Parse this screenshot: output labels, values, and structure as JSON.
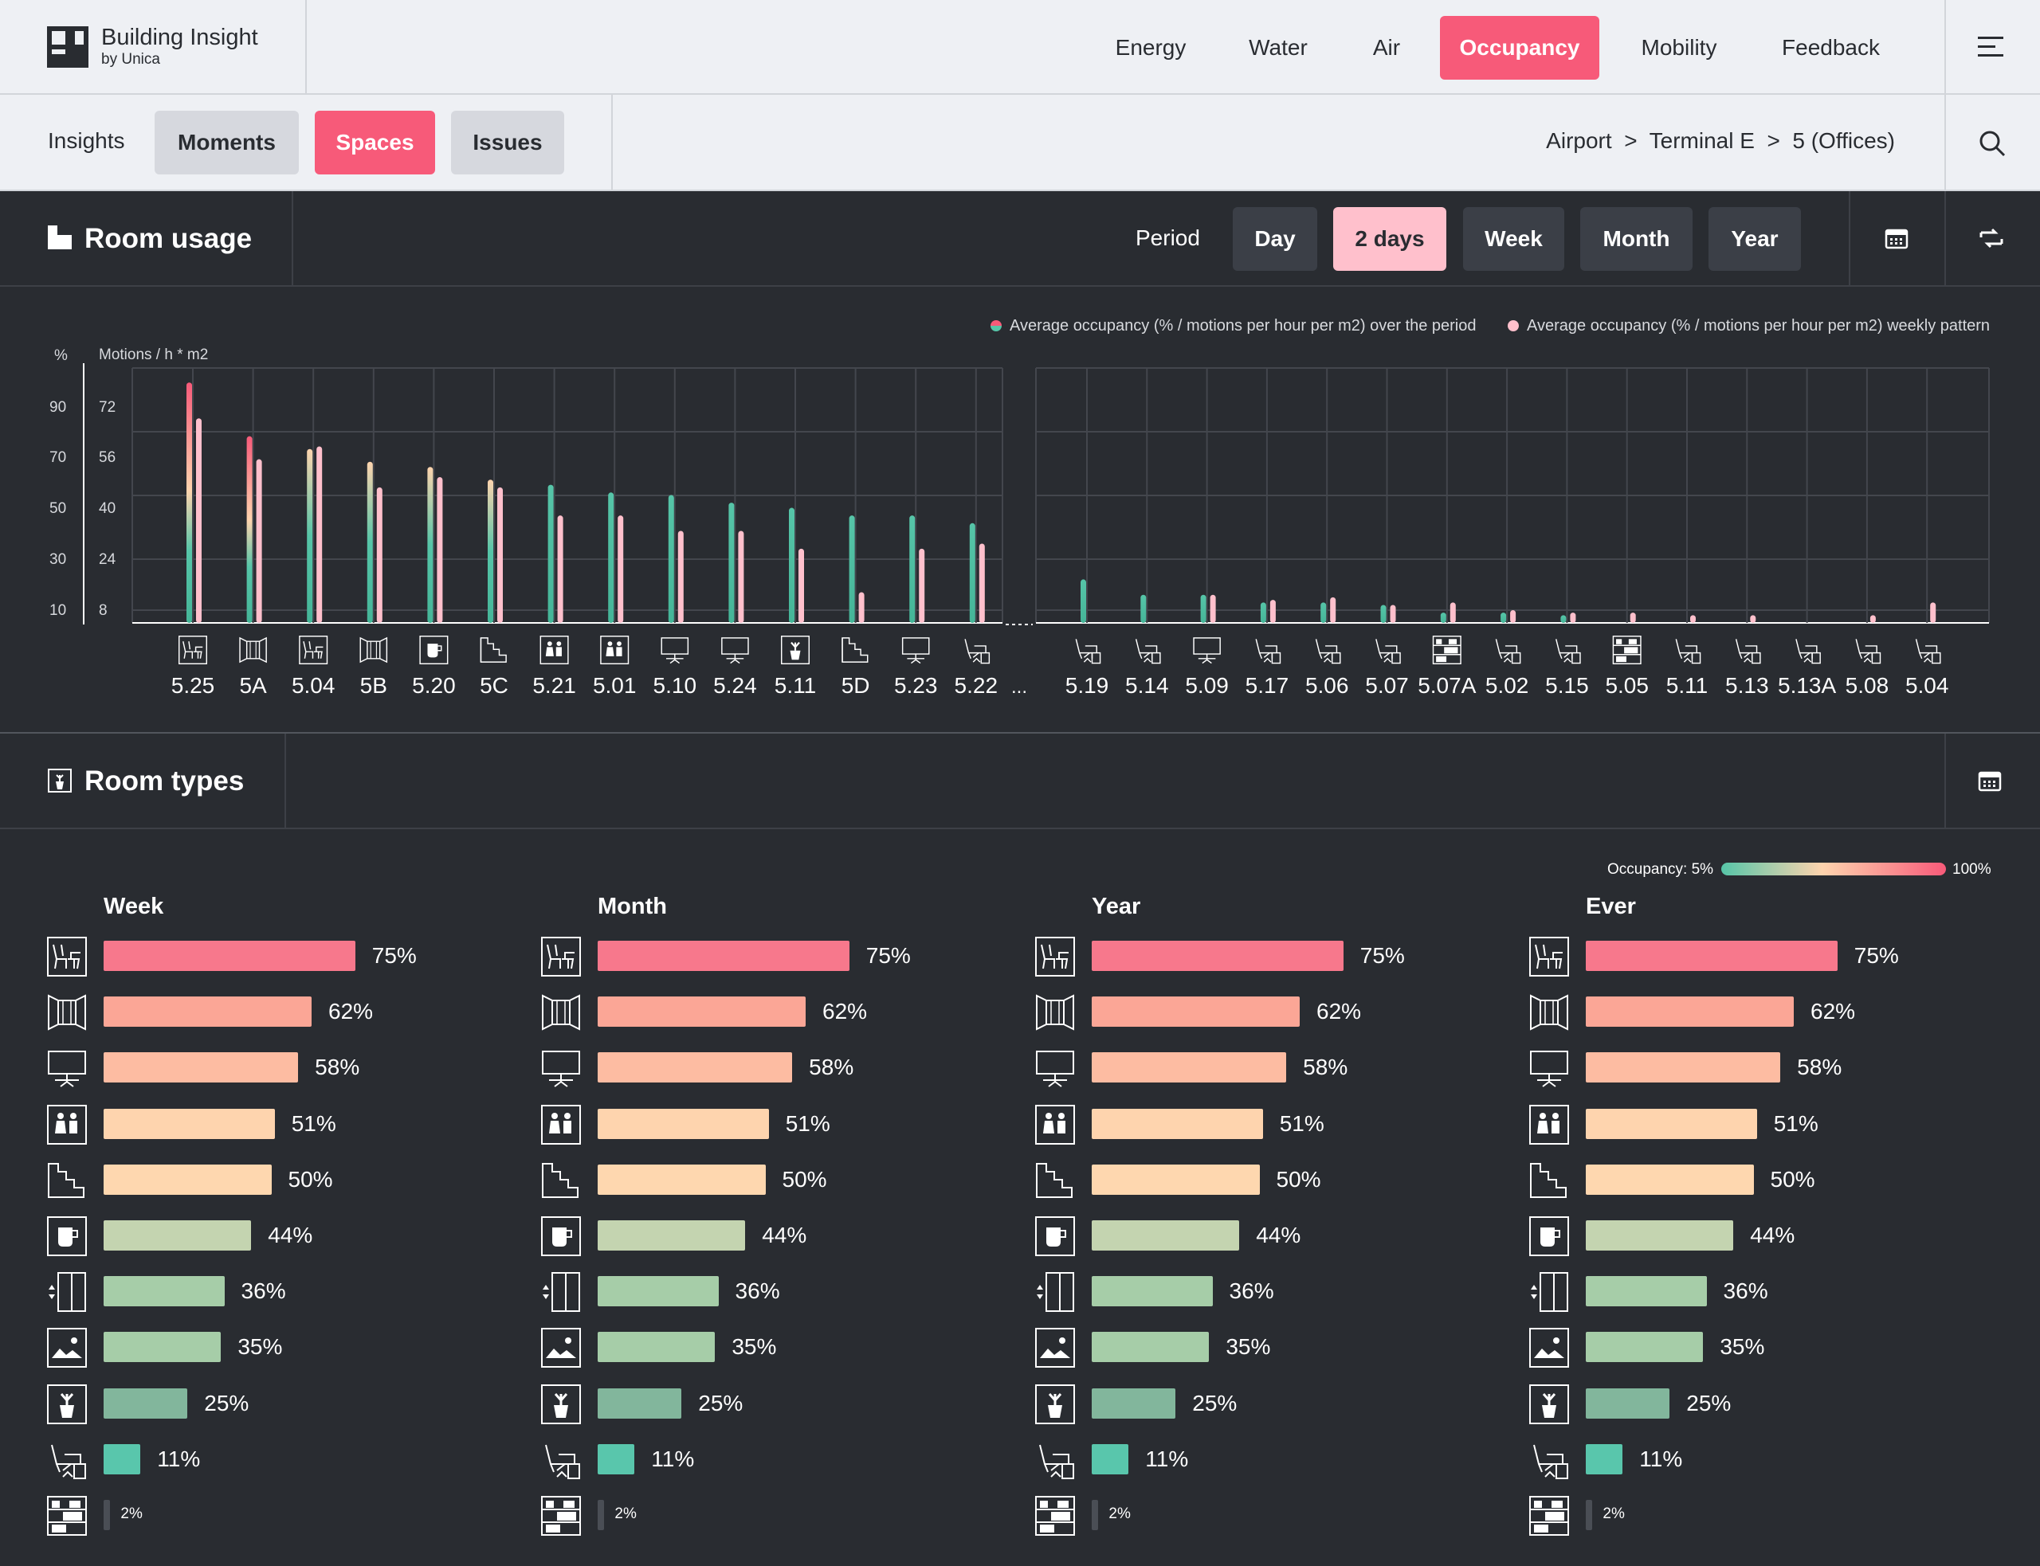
{
  "app": {
    "title": "Building Insight",
    "subtitle": "by Unica"
  },
  "nav": {
    "items": [
      "Energy",
      "Water",
      "Air",
      "Occupancy",
      "Mobility",
      "Feedback"
    ],
    "active": "Occupancy"
  },
  "subnav": {
    "insights_label": "Insights",
    "tabs": [
      "Moments",
      "Spaces",
      "Issues"
    ],
    "active": "Spaces"
  },
  "breadcrumb": {
    "items": [
      "Airport",
      "Terminal E",
      "5 (Offices)"
    ],
    "separator": ">"
  },
  "room_usage": {
    "title": "Room usage",
    "period_label": "Period",
    "periods": [
      "Day",
      "2 days",
      "Week",
      "Month",
      "Year"
    ],
    "active_period": "2 days",
    "legend": [
      "Average occupancy (% / motions per hour per m2) over the period",
      "Average occupancy (% / motions per hour per m2) weekly pattern"
    ],
    "ellipsis": "..."
  },
  "chart_data": {
    "type": "bar",
    "ylabel_left": "%",
    "ylabel_right": "Motions / h * m2",
    "yticks_pct": [
      90,
      70,
      50,
      30,
      10
    ],
    "yticks_motion": [
      72,
      56,
      40,
      24,
      8
    ],
    "ylim": [
      0,
      100
    ],
    "series": [
      {
        "name": "Average occupancy (% / motions per hour per m2) over the period",
        "values": [
          94,
          73,
          68,
          63,
          61,
          56,
          54,
          51,
          50,
          47,
          45,
          42,
          42,
          39,
          17,
          11,
          11,
          8,
          8,
          7,
          4,
          4,
          3,
          0,
          0,
          0,
          0,
          0,
          0
        ]
      },
      {
        "name": "Average occupancy (% / motions per hour per m2) weekly pattern",
        "values": [
          80,
          64,
          69,
          53,
          57,
          53,
          42,
          42,
          36,
          36,
          29,
          12,
          29,
          31,
          0,
          0,
          11,
          9,
          10,
          7,
          8,
          5,
          4,
          4,
          3,
          3,
          0,
          3,
          8
        ]
      }
    ],
    "categories": [
      "5.25",
      "5A",
      "5.04",
      "5B",
      "5.20",
      "5C",
      "5.21",
      "5.01",
      "5.10",
      "5.24",
      "5.11",
      "5D",
      "5.23",
      "5.22",
      "5.19",
      "5.14",
      "5.09",
      "5.17",
      "5.06",
      "5.07",
      "5.07A",
      "5.02",
      "5.15",
      "5.05",
      "5.11",
      "5.13",
      "5.13A",
      "5.08",
      "5.04"
    ],
    "category_icons": [
      "lounge-icon",
      "meeting-room-icon",
      "lounge-icon",
      "meeting-room-icon",
      "pantry-icon",
      "stairs-icon",
      "restroom-icon",
      "restroom-icon",
      "presentation-icon",
      "presentation-icon",
      "plant-icon",
      "stairs-icon",
      "presentation-icon",
      "office-chair-icon",
      "office-chair-icon",
      "office-chair-icon",
      "presentation-icon",
      "office-chair-icon",
      "office-chair-icon",
      "office-chair-icon",
      "storage-icon",
      "office-chair-icon",
      "office-chair-icon",
      "storage-icon",
      "office-chair-icon",
      "office-chair-icon",
      "office-chair-icon",
      "office-chair-icon",
      "office-chair-icon"
    ]
  },
  "room_types": {
    "title": "Room types",
    "occupancy_label": "Occupancy: 5%",
    "occupancy_max": "100%",
    "columns": [
      "Week",
      "Month",
      "Year",
      "Ever"
    ],
    "rows": [
      {
        "icon": "lounge-icon",
        "value": 75,
        "label": "75%",
        "color": "#f7788c"
      },
      {
        "icon": "meeting-room-icon",
        "value": 62,
        "label": "62%",
        "color": "#fba696"
      },
      {
        "icon": "presentation-icon",
        "value": 58,
        "label": "58%",
        "color": "#fdbca2"
      },
      {
        "icon": "restroom-icon",
        "value": 51,
        "label": "51%",
        "color": "#fed4ae"
      },
      {
        "icon": "stairs-icon",
        "value": 50,
        "label": "50%",
        "color": "#fed7af"
      },
      {
        "icon": "pantry-icon",
        "value": 44,
        "label": "44%",
        "color": "#c4d4b0"
      },
      {
        "icon": "elevator-icon",
        "value": 36,
        "label": "36%",
        "color": "#a6cda8"
      },
      {
        "icon": "gallery-icon",
        "value": 35,
        "label": "35%",
        "color": "#a6cda8"
      },
      {
        "icon": "plant-icon",
        "value": 25,
        "label": "25%",
        "color": "#82b69c"
      },
      {
        "icon": "office-chair-icon",
        "value": 11,
        "label": "11%",
        "color": "#59c6ac"
      },
      {
        "icon": "storage-icon",
        "value": 2,
        "label": "2%",
        "color": "#4a4e55"
      }
    ]
  }
}
